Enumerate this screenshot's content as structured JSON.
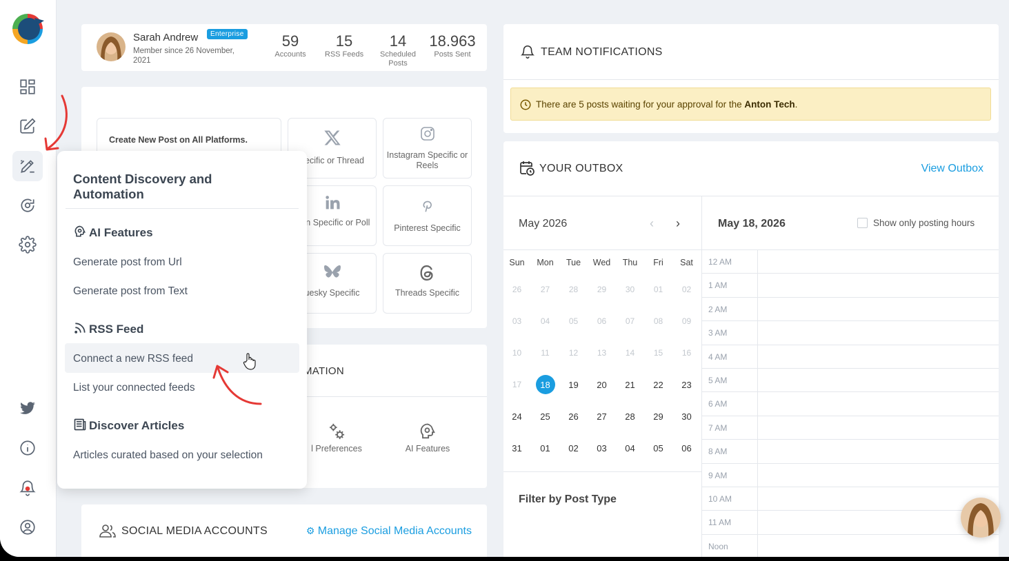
{
  "profile": {
    "name": "Sarah Andrew",
    "badge": "Enterprise",
    "member_since": "Member since 26 November, 2021",
    "stats": [
      {
        "num": "59",
        "label": "Accounts"
      },
      {
        "num": "15",
        "label": "RSS Feeds"
      },
      {
        "num": "14",
        "label": "Scheduled Posts"
      },
      {
        "num": "18.963",
        "label": "Posts Sent"
      }
    ]
  },
  "create_post": {
    "label": "Create New Post on All Platforms.",
    "tiles": [
      {
        "label": "pecific or Thread",
        "icon": "x-logo-icon"
      },
      {
        "label": "Instagram Specific or Reels",
        "icon": "instagram-icon"
      },
      {
        "label": "edin Specific or Poll",
        "icon": "linkedin-icon"
      },
      {
        "label": "Pinterest Specific",
        "icon": "pinterest-icon"
      },
      {
        "label": "uesky Specific",
        "icon": "bluesky-icon"
      },
      {
        "label": "Threads Specific",
        "icon": "threads-icon"
      }
    ]
  },
  "automation": {
    "title": "MATION",
    "items": [
      {
        "label": "l Preferences",
        "icon": "gears-icon"
      },
      {
        "label": "AI Features",
        "icon": "ai-brain-icon"
      }
    ]
  },
  "social": {
    "title": "SOCIAL MEDIA ACCOUNTS",
    "link": "Manage Social Media Accounts"
  },
  "notifications": {
    "title": "TEAM NOTIFICATIONS",
    "alert_prefix": "There are 5 posts waiting for your approval for the",
    "alert_bold": "Anton Tech",
    "alert_suffix": "."
  },
  "outbox": {
    "title": "YOUR OUTBOX",
    "view_link": "View Outbox",
    "month": "May 2026",
    "prev": "‹",
    "next": "›",
    "weekdays": [
      "Sun",
      "Mon",
      "Tue",
      "Wed",
      "Thu",
      "Fri",
      "Sat"
    ],
    "weeks": [
      [
        "26",
        "27",
        "28",
        "29",
        "30",
        "01",
        "02"
      ],
      [
        "03",
        "04",
        "05",
        "06",
        "07",
        "08",
        "09"
      ],
      [
        "10",
        "11",
        "12",
        "13",
        "14",
        "15",
        "16"
      ],
      [
        "17",
        "18",
        "19",
        "20",
        "21",
        "22",
        "23"
      ],
      [
        "24",
        "25",
        "26",
        "27",
        "28",
        "29",
        "30"
      ],
      [
        "31",
        "01",
        "02",
        "03",
        "04",
        "05",
        "06"
      ]
    ],
    "today": "18",
    "filter_title": "Filter by Post Type",
    "selected_date": "May 18, 2026",
    "posting_hours_label": "Show only posting hours",
    "hours": [
      "12 AM",
      "1 AM",
      "2 AM",
      "3 AM",
      "4 AM",
      "5 AM",
      "6 AM",
      "7 AM",
      "8 AM",
      "9 AM",
      "10 AM",
      "11 AM",
      "Noon"
    ]
  },
  "popup": {
    "title": "Content Discovery and Automation",
    "sections": [
      {
        "title": "AI Features",
        "icon": "ai-brain-icon",
        "items": [
          "Generate post from Url",
          "Generate post from Text"
        ]
      },
      {
        "title": "RSS Feed",
        "icon": "rss-icon",
        "items": [
          "Connect a new RSS feed",
          "List your connected feeds"
        ]
      },
      {
        "title": "Discover Articles",
        "icon": "newspaper-icon",
        "items": [
          "Articles curated based on your selection"
        ]
      }
    ]
  },
  "colors": {
    "accent": "#1a9de0",
    "alert_bg": "#fbefc4",
    "annotation": "#e53935"
  }
}
